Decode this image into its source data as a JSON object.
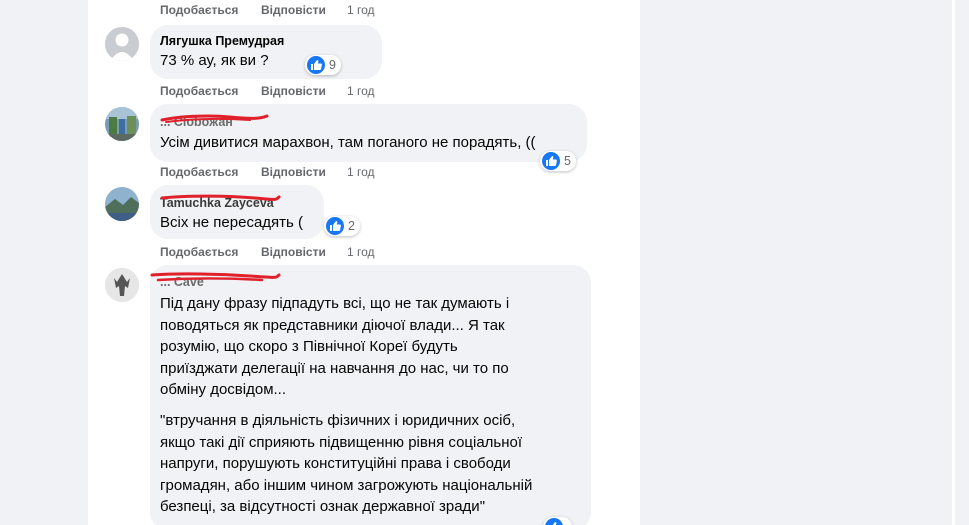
{
  "actions": {
    "like": "Подобається",
    "reply": "Відповісти"
  },
  "top_row": {
    "time": "1 год"
  },
  "comments": [
    {
      "author": "Лягушка Премудрая",
      "text": "73 % ау, як ви ?",
      "reactions": "9",
      "time": "1 год"
    },
    {
      "author": "... Cloboжан",
      "text": "Усім дивитися марахвон, там поганого не порадять, ((",
      "reactions": "5",
      "time": "1 год"
    },
    {
      "author": "Tamuchka Zayceva",
      "text": "Всіх не пересадять (",
      "reactions": "2",
      "time": "1 год"
    },
    {
      "author": "... Cave",
      "para1": [
        "Під дану фразу підпадуть всі, що не так думають і",
        "поводяться як представники діючої влади... Я так",
        "розумію, що скоро з Північної Кореї будуть",
        "приїзджати делегації на навчання до нас, чи то по",
        "обміну досвідом..."
      ],
      "para2": [
        "\"втручання в діяльність фізичних і юридичних осіб,",
        "якщо такі дії сприяють підвищенню рівня соціальної",
        "напруги, порушують конституційні права і свободи",
        "громадян, або іншим чином загрожують національній",
        "безпеці, за відсутності ознак державної зради\""
      ]
    }
  ],
  "colors": {
    "like_blue": "#1877f2",
    "redaction": "#e0202a",
    "meta_grey": "#65676b"
  },
  "icons": [
    "thumbs-up-icon",
    "default-avatar-icon"
  ]
}
